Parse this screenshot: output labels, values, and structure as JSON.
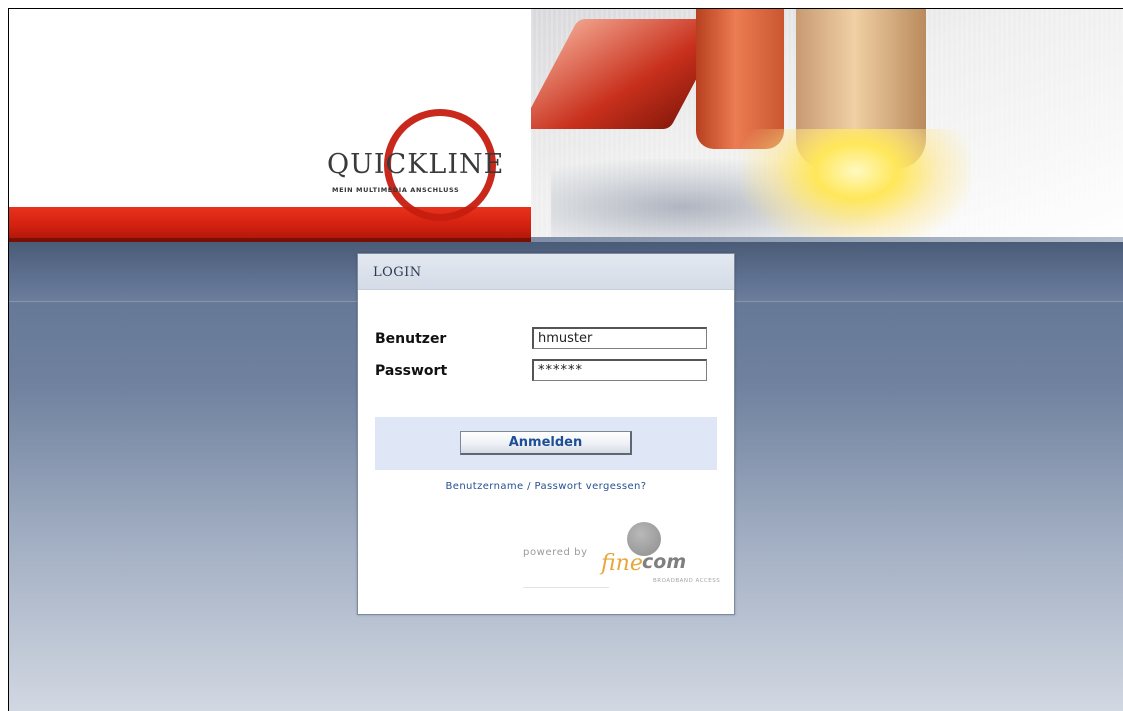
{
  "brand": {
    "logo_text": "QUICKLINE",
    "tagline": "MEIN MULTIMEDIA ANSCHLUSS"
  },
  "login": {
    "title": "LOGIN",
    "username_label": "Benutzer",
    "username_value": "hmuster",
    "password_label": "Passwort",
    "password_value": "******",
    "submit_label": "Anmelden",
    "forgot_link": "Benutzername / Passwort vergessen?"
  },
  "footer": {
    "powered_by": "powered by",
    "partner_fine": "fine",
    "partner_com": "com",
    "partner_sub": "BROADBAND ACCESS"
  },
  "colors": {
    "brand_red": "#d2200f",
    "link_blue": "#27508f",
    "button_text": "#1e4f96",
    "partner_orange": "#e8a63a"
  }
}
